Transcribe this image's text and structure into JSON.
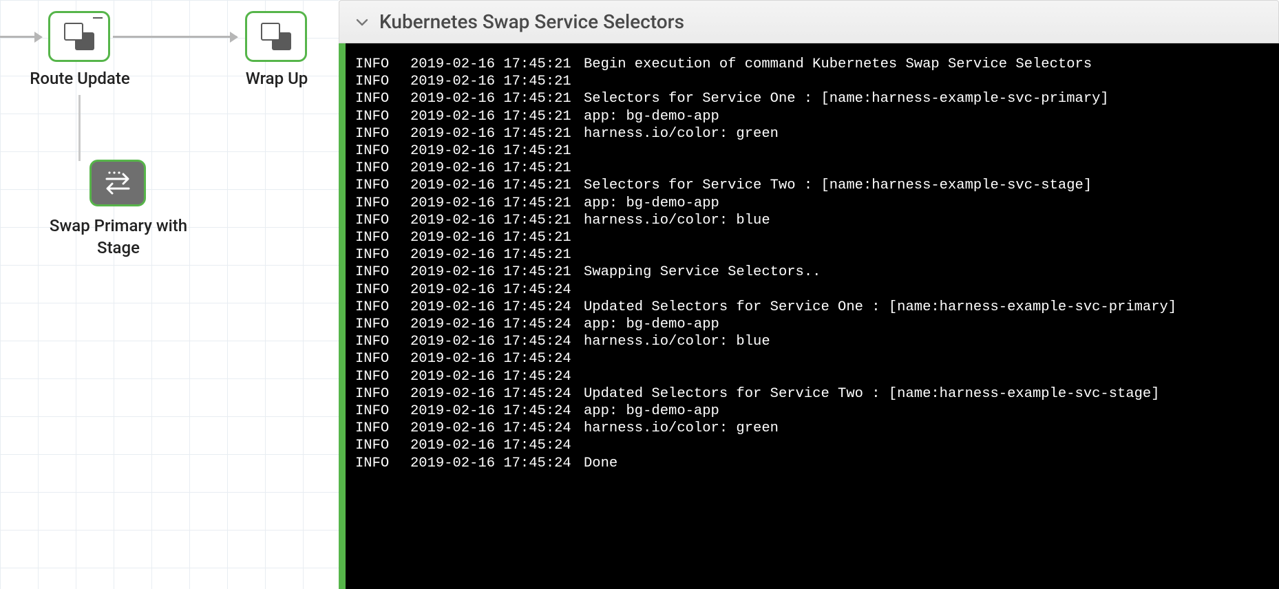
{
  "canvas": {
    "nodes": {
      "route_update": {
        "label": "Route Update"
      },
      "wrap_up": {
        "label": "Wrap Up"
      },
      "swap": {
        "label": "Swap Primary with Stage"
      }
    }
  },
  "panel": {
    "title": "Kubernetes Swap Service Selectors"
  },
  "logs": [
    {
      "level": "INFO",
      "ts": "2019-02-16 17:45:21",
      "msg": "Begin execution of command Kubernetes Swap Service Selectors"
    },
    {
      "level": "INFO",
      "ts": "2019-02-16 17:45:21",
      "msg": ""
    },
    {
      "level": "INFO",
      "ts": "2019-02-16 17:45:21",
      "msg": "Selectors for Service One : [name:harness-example-svc-primary]"
    },
    {
      "level": "INFO",
      "ts": "2019-02-16 17:45:21",
      "msg": "app: bg-demo-app"
    },
    {
      "level": "INFO",
      "ts": "2019-02-16 17:45:21",
      "msg": "harness.io/color: green"
    },
    {
      "level": "INFO",
      "ts": "2019-02-16 17:45:21",
      "msg": ""
    },
    {
      "level": "INFO",
      "ts": "2019-02-16 17:45:21",
      "msg": ""
    },
    {
      "level": "INFO",
      "ts": "2019-02-16 17:45:21",
      "msg": "Selectors for Service Two : [name:harness-example-svc-stage]"
    },
    {
      "level": "INFO",
      "ts": "2019-02-16 17:45:21",
      "msg": "app: bg-demo-app"
    },
    {
      "level": "INFO",
      "ts": "2019-02-16 17:45:21",
      "msg": "harness.io/color: blue"
    },
    {
      "level": "INFO",
      "ts": "2019-02-16 17:45:21",
      "msg": ""
    },
    {
      "level": "INFO",
      "ts": "2019-02-16 17:45:21",
      "msg": ""
    },
    {
      "level": "INFO",
      "ts": "2019-02-16 17:45:21",
      "msg": "Swapping Service Selectors.."
    },
    {
      "level": "INFO",
      "ts": "2019-02-16 17:45:24",
      "msg": ""
    },
    {
      "level": "INFO",
      "ts": "2019-02-16 17:45:24",
      "msg": "Updated Selectors for Service One : [name:harness-example-svc-primary]"
    },
    {
      "level": "INFO",
      "ts": "2019-02-16 17:45:24",
      "msg": "app: bg-demo-app"
    },
    {
      "level": "INFO",
      "ts": "2019-02-16 17:45:24",
      "msg": "harness.io/color: blue"
    },
    {
      "level": "INFO",
      "ts": "2019-02-16 17:45:24",
      "msg": ""
    },
    {
      "level": "INFO",
      "ts": "2019-02-16 17:45:24",
      "msg": ""
    },
    {
      "level": "INFO",
      "ts": "2019-02-16 17:45:24",
      "msg": "Updated Selectors for Service Two : [name:harness-example-svc-stage]"
    },
    {
      "level": "INFO",
      "ts": "2019-02-16 17:45:24",
      "msg": "app: bg-demo-app"
    },
    {
      "level": "INFO",
      "ts": "2019-02-16 17:45:24",
      "msg": "harness.io/color: green"
    },
    {
      "level": "INFO",
      "ts": "2019-02-16 17:45:24",
      "msg": ""
    },
    {
      "level": "INFO",
      "ts": "2019-02-16 17:45:24",
      "msg": "Done"
    }
  ]
}
